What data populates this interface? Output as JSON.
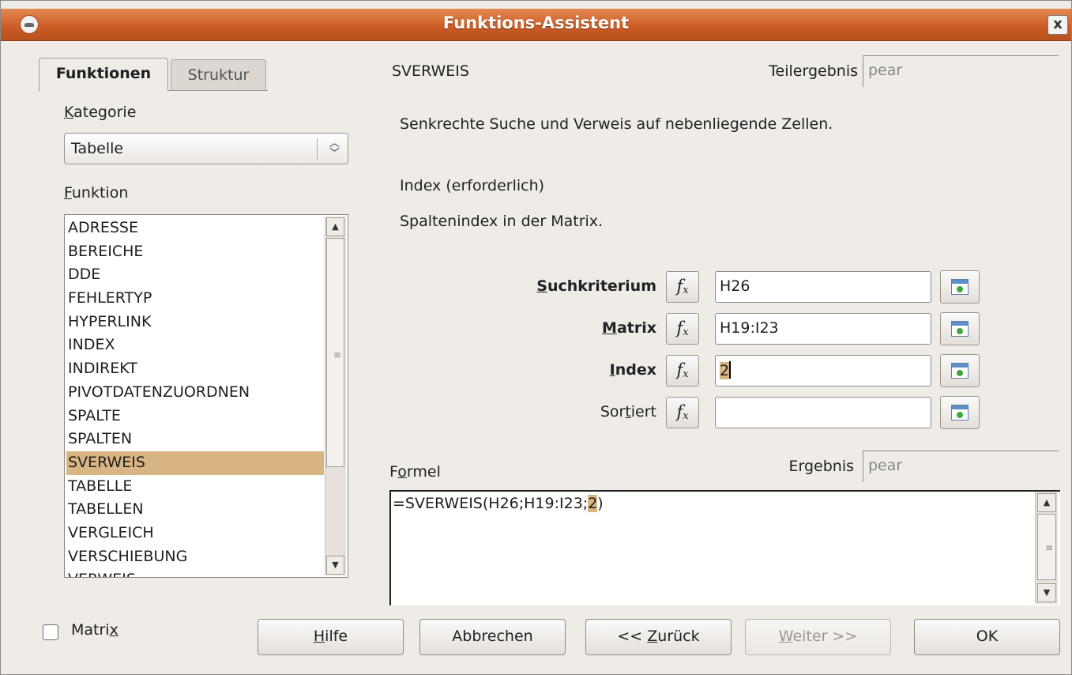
{
  "window": {
    "title": "Funktions-Assistent",
    "close_glyph": "x"
  },
  "tabs": {
    "functions": "Funktionen",
    "structure": "Struktur"
  },
  "left": {
    "category_label_u": "K",
    "category_label_rest": "ategorie",
    "category_value": "Tabelle",
    "function_label_u": "F",
    "function_label_rest": "unktion",
    "functions": [
      "ADRESSE",
      "BEREICHE",
      "DDE",
      "FEHLERTYP",
      "HYPERLINK",
      "INDEX",
      "INDIREKT",
      "PIVOTDATENZUORDNEN",
      "SPALTE",
      "SPALTEN",
      "SVERWEIS",
      "TABELLE",
      "TABELLEN",
      "VERGLEICH",
      "VERSCHIEBUNG",
      "VERWEIS"
    ],
    "selected_function": "SVERWEIS"
  },
  "right": {
    "function_name": "SVERWEIS",
    "subresult_label": "Teilergebnis",
    "subresult_value": "pear",
    "description": "Senkrechte Suche und Verweis auf nebenliegende Zellen.",
    "param_title": "Index  (erforderlich)",
    "param_description": "Spaltenindex in der Matrix.",
    "arguments": [
      {
        "label_pre": "",
        "label_u": "S",
        "label_post": "uchkriterium",
        "value": "H26",
        "required": true
      },
      {
        "label_pre": "",
        "label_u": "M",
        "label_post": "atrix",
        "value": "H19:I23",
        "required": true
      },
      {
        "label_pre": "",
        "label_u": "I",
        "label_post": "ndex",
        "value": "2",
        "required": true
      },
      {
        "label_pre": "Sor",
        "label_u": "t",
        "label_post": "iert",
        "value": "",
        "required": false
      }
    ],
    "fx_glyph": "f",
    "fx_sub": "x",
    "formula_label_pre": "F",
    "formula_label_u": "o",
    "formula_label_post": "rmel",
    "result_label": "Ergebnis",
    "result_value": "pear",
    "formula_pre": "=SVERWEIS(H26;H19:I23;",
    "formula_highlight": "2",
    "formula_post": ")"
  },
  "bottom": {
    "matrix_label_pre": "Matri",
    "matrix_label_u": "x",
    "help_u": "H",
    "help_rest": "ilfe",
    "cancel": "Abbrechen",
    "back_pre": "<< ",
    "back_u": "Z",
    "back_rest": "urück",
    "next_u": "W",
    "next_rest": "eiter >>",
    "ok": "OK"
  }
}
